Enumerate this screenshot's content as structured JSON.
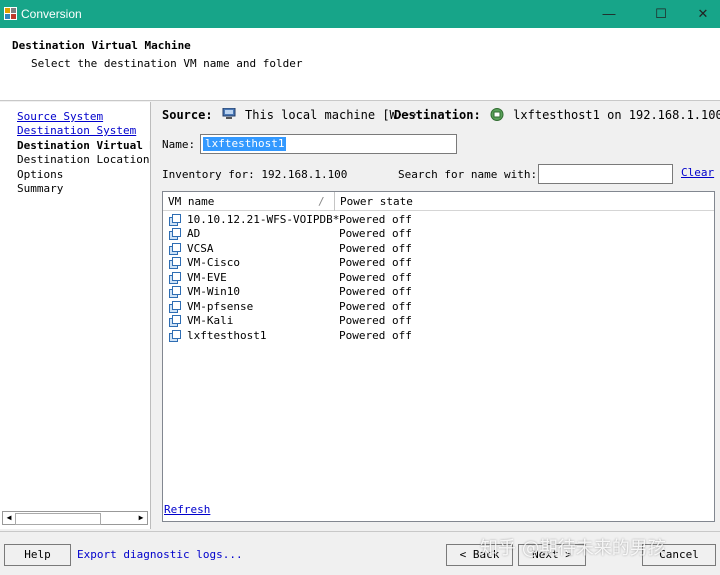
{
  "window": {
    "title": "Conversion",
    "minimize": "—",
    "maximize": "☐",
    "close": "✕"
  },
  "header": {
    "title": "Destination Virtual Machine",
    "subtitle": "Select the destination VM name and folder"
  },
  "nav": {
    "items": [
      {
        "label": "Source System",
        "state": "link"
      },
      {
        "label": "Destination System",
        "state": "link"
      },
      {
        "label": "Destination Virtual Machine",
        "state": "active"
      },
      {
        "label": "Destination Location",
        "state": "normal"
      },
      {
        "label": "Options",
        "state": "normal"
      },
      {
        "label": "Summary",
        "state": "normal"
      }
    ]
  },
  "source": {
    "label": "Source:",
    "value": "This local machine [W···",
    "icon": "computer-icon"
  },
  "destination": {
    "label": "Destination:",
    "value": "lxftesthost1 on 192.168.1.100 ···",
    "icon": "network-vm-icon"
  },
  "name_field": {
    "label": "Name:",
    "value": "lxftesthost1"
  },
  "inventory": {
    "label": "Inventory for: 192.168.1.100"
  },
  "search": {
    "label": "Search for name with:",
    "value": "",
    "clear": "Clear"
  },
  "vm_list": {
    "columns": [
      "VM name",
      "Power state"
    ],
    "sort_indicator": "/",
    "rows": [
      {
        "name": "10.10.12.21-WFS-VOIPDB*",
        "state": "Powered off"
      },
      {
        "name": "AD",
        "state": "Powered off"
      },
      {
        "name": "VCSA",
        "state": "Powered off"
      },
      {
        "name": "VM-Cisco",
        "state": "Powered off"
      },
      {
        "name": "VM-EVE",
        "state": "Powered off"
      },
      {
        "name": "VM-Win10",
        "state": "Powered off"
      },
      {
        "name": "VM-pfsense",
        "state": "Powered off"
      },
      {
        "name": "VM-Kali",
        "state": "Powered off"
      },
      {
        "name": "lxftesthost1",
        "state": "Powered off"
      }
    ]
  },
  "refresh": "Refresh",
  "footer": {
    "help": "Help",
    "export": "Export diagnostic logs...",
    "back": "< Back",
    "next": "Next >",
    "cancel": "Cancel"
  },
  "watermark": "知乎 @期待未来的男孩",
  "colors": {
    "titlebar": "#17a589",
    "link": "#0000cc",
    "selection": "#3399ff"
  }
}
